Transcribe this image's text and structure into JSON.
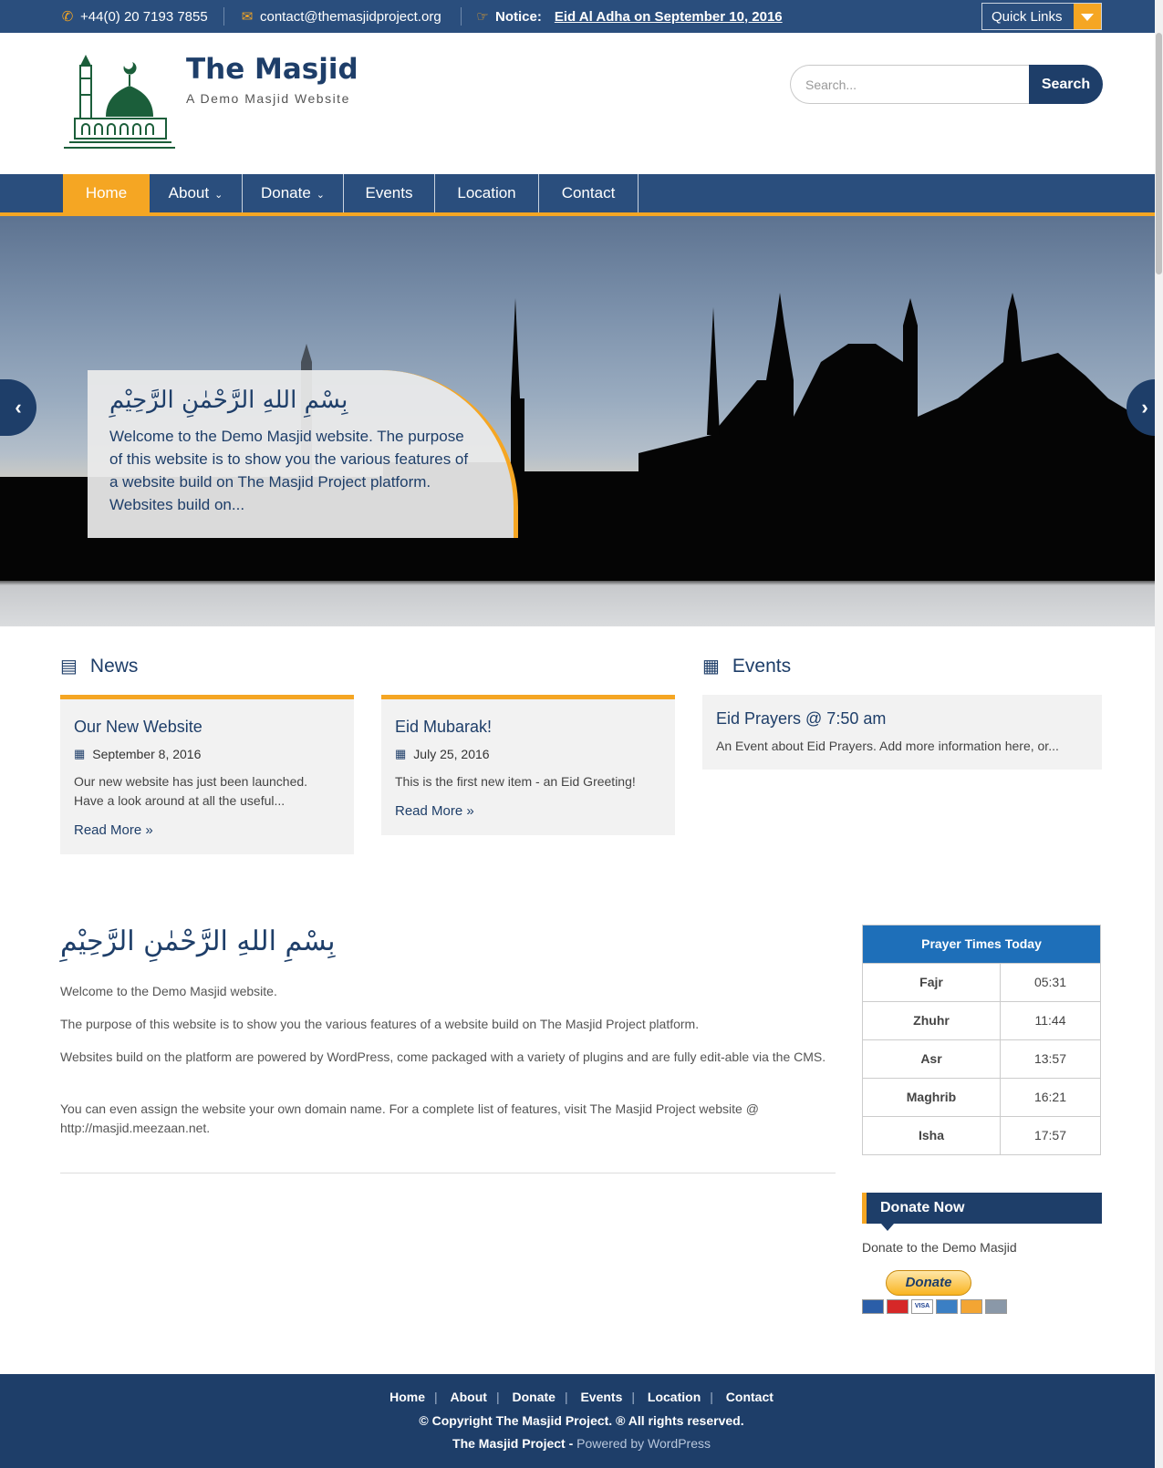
{
  "topbar": {
    "phone": "+44(0) 20 7193 7855",
    "email": "contact@themasjidproject.org",
    "notice_label": "Notice:",
    "notice_text": "Eid Al Adha on September 10, 2016",
    "quick_links": "Quick Links",
    "icons": {
      "phone": "phone-icon",
      "email": "envelope-icon",
      "notice": "hand-pointing-icon"
    }
  },
  "header": {
    "title": "The Masjid",
    "tagline": "A Demo Masjid Website",
    "search_placeholder": "Search...",
    "search_button": "Search"
  },
  "nav": {
    "items": [
      {
        "label": "Home"
      },
      {
        "label": "About"
      },
      {
        "label": "Donate"
      },
      {
        "label": "Events"
      },
      {
        "label": "Location"
      },
      {
        "label": "Contact"
      }
    ]
  },
  "hero": {
    "arabic": "بِسْمِ اللهِ الرَّحْمٰنِ الرَّحِيْمِ",
    "text": "Welcome to the Demo Masjid website. The purpose of this website is to show you the various features of a website build on The Masjid Project platform. Websites build on..."
  },
  "news": {
    "heading": "News",
    "items": [
      {
        "title": "Our New Website",
        "date": "September 8, 2016",
        "excerpt": "Our new website has just been launched. Have a look around at all the useful...",
        "more": "Read More »"
      },
      {
        "title": "Eid Mubarak!",
        "date": "July 25, 2016",
        "excerpt": "This is the first new item - an Eid Greeting!",
        "more": "Read More »"
      }
    ]
  },
  "events": {
    "heading": "Events",
    "items": [
      {
        "title": "Eid Prayers @ 7:50 am",
        "text": "An Event about Eid Prayers. Add more information here, or..."
      }
    ]
  },
  "main": {
    "arabic": "بِسْمِ اللهِ الرَّحْمٰنِ الرَّحِيْمِ",
    "paragraphs": [
      "Welcome to the Demo Masjid website.",
      "The purpose of this website is to show you the various features of a website build on The Masjid Project platform.",
      "Websites build on the platform are powered by WordPress, come packaged with a variety of plugins and are fully edit-able via the CMS.",
      "You can even assign the website your own domain name. For a complete list of features, visit The Masjid Project website @ http://masjid.meezaan.net."
    ]
  },
  "prayer_times": {
    "heading": "Prayer Times Today",
    "rows": [
      {
        "name": "Fajr",
        "time": "05:31"
      },
      {
        "name": "Zhuhr",
        "time": "11:44"
      },
      {
        "name": "Asr",
        "time": "13:57"
      },
      {
        "name": "Maghrib",
        "time": "16:21"
      },
      {
        "name": "Isha",
        "time": "17:57"
      }
    ]
  },
  "donate": {
    "heading": "Donate Now",
    "text": "Donate to the Demo Masjid",
    "button": "Donate"
  },
  "footer": {
    "links": [
      "Home",
      "About",
      "Donate",
      "Events",
      "Location",
      "Contact"
    ],
    "copyright": "© Copyright The Masjid Project. ® All rights reserved.",
    "powered_brand": "The Masjid Project",
    "powered_sep": " - ",
    "powered_by": "Powered by WordPress"
  },
  "colors": {
    "primary": "#1e3e69",
    "topbar": "#2a4e7d",
    "accent": "#f5a623",
    "prayer_header": "#1e6fb9"
  }
}
